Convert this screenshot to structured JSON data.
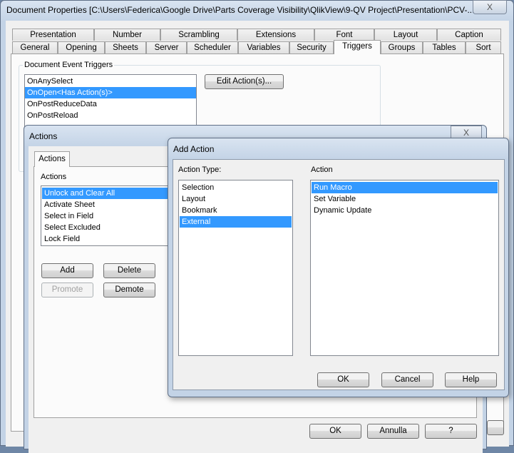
{
  "doc_props": {
    "title": "Document Properties [C:\\Users\\Federica\\Google Drive\\Parts Coverage Visibility\\QlikView\\9-QV Project\\Presentation\\PCV-...",
    "close": "X",
    "tabs_row1": [
      "Presentation",
      "Number",
      "Scrambling",
      "Extensions",
      "Font",
      "Layout",
      "Caption"
    ],
    "tabs_row2": [
      "General",
      "Opening",
      "Sheets",
      "Server",
      "Scheduler",
      "Variables",
      "Security",
      "Triggers",
      "Groups",
      "Tables",
      "Sort"
    ],
    "active_tab": "Triggers",
    "group_label": "Document Event Triggers",
    "triggers": [
      "OnAnySelect",
      "OnOpen<Has Action(s)>",
      "OnPostReduceData",
      "OnPostReload"
    ],
    "selected_trigger": "OnOpen<Has Action(s)>",
    "edit_button": "Edit Action(s)..."
  },
  "actions_dialog": {
    "title": "Actions",
    "close": "X",
    "tab": "Actions",
    "list_label": "Actions",
    "actions": [
      "Unlock and Clear All",
      "Activate Sheet",
      "Select in Field",
      "Select Excluded",
      "Lock Field"
    ],
    "selected": "Unlock and Clear All",
    "add": "Add",
    "delete": "Delete",
    "promote": "Promote",
    "demote": "Demote",
    "ok": "OK",
    "cancel": "Annulla",
    "help": "?"
  },
  "add_action": {
    "title": "Add Action",
    "type_label": "Action Type:",
    "types": [
      "Selection",
      "Layout",
      "Bookmark",
      "External"
    ],
    "selected_type": "External",
    "action_label": "Action",
    "actions": [
      "Run Macro",
      "Set Variable",
      "Dynamic Update"
    ],
    "selected_action": "Run Macro",
    "ok": "OK",
    "cancel": "Cancel",
    "help": "Help"
  }
}
